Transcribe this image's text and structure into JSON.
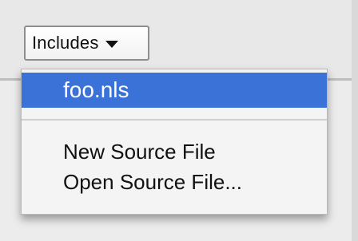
{
  "dropdown": {
    "label": "Includes",
    "caret_icon": "triangle-down"
  },
  "menu": {
    "items": [
      {
        "label": "foo.nls",
        "selected": true
      },
      {
        "label": "New Source File",
        "selected": false
      },
      {
        "label": "Open Source File...",
        "selected": false
      }
    ],
    "highlight_color": "#3a72d8"
  }
}
